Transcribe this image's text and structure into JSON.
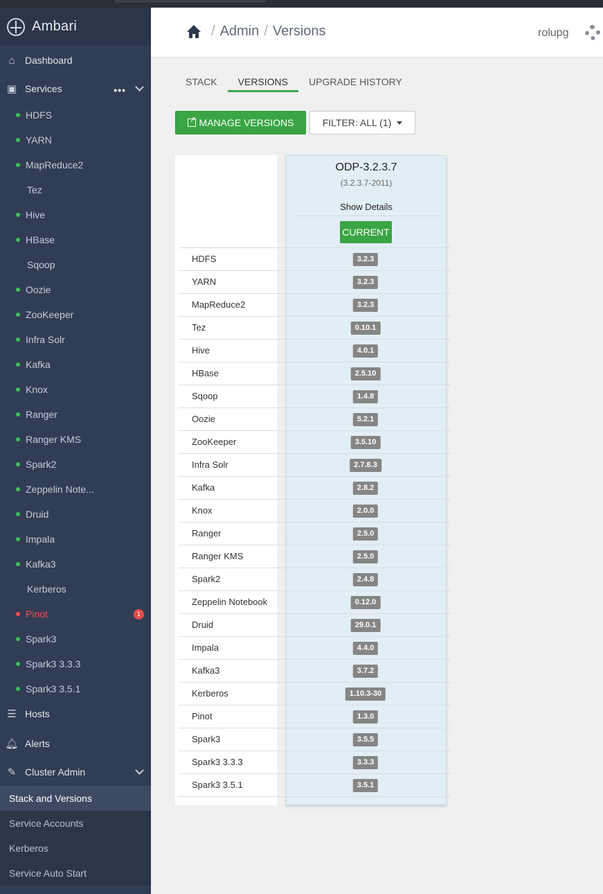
{
  "app": {
    "title": "Ambari"
  },
  "sidebar": {
    "dashboard": "Dashboard",
    "services": "Services",
    "services_more": "•••",
    "service_items": [
      {
        "label": "HDFS",
        "status": "green"
      },
      {
        "label": "YARN",
        "status": "green"
      },
      {
        "label": "MapReduce2",
        "status": "green"
      },
      {
        "label": "Tez",
        "status": "none"
      },
      {
        "label": "Hive",
        "status": "green"
      },
      {
        "label": "HBase",
        "status": "green"
      },
      {
        "label": "Sqoop",
        "status": "none"
      },
      {
        "label": "Oozie",
        "status": "green"
      },
      {
        "label": "ZooKeeper",
        "status": "green"
      },
      {
        "label": "Infra Solr",
        "status": "green"
      },
      {
        "label": "Kafka",
        "status": "green"
      },
      {
        "label": "Knox",
        "status": "green"
      },
      {
        "label": "Ranger",
        "status": "green"
      },
      {
        "label": "Ranger KMS",
        "status": "green"
      },
      {
        "label": "Spark2",
        "status": "green"
      },
      {
        "label": "Zeppelin Note...",
        "status": "green"
      },
      {
        "label": "Druid",
        "status": "green"
      },
      {
        "label": "Impala",
        "status": "green"
      },
      {
        "label": "Kafka3",
        "status": "green"
      },
      {
        "label": "Kerberos",
        "status": "none"
      },
      {
        "label": "Pinot",
        "status": "red",
        "alerts": "1"
      },
      {
        "label": "Spark3",
        "status": "green"
      },
      {
        "label": "Spark3 3.3.3",
        "status": "green"
      },
      {
        "label": "Spark3 3.5.1",
        "status": "green"
      }
    ],
    "hosts": "Hosts",
    "alerts": "Alerts",
    "cluster_admin": "Cluster Admin",
    "cluster_admin_items": [
      "Stack and Versions",
      "Service Accounts",
      "Kerberos",
      "Service Auto Start"
    ]
  },
  "header": {
    "crumb_admin": "Admin",
    "crumb_versions": "Versions",
    "separator": "/",
    "user": "rolupg"
  },
  "tabs": [
    "STACK",
    "VERSIONS",
    "UPGRADE HISTORY"
  ],
  "toolbar": {
    "manage_label": "MANAGE VERSIONS",
    "filter_label": "FILTER: ALL (1)"
  },
  "version": {
    "name": "ODP-3.2.3.7",
    "build": "(3.2.3.7-2011)",
    "show_details": "Show Details",
    "state": "CURRENT"
  },
  "components": [
    {
      "name": "HDFS",
      "version": "3.2.3"
    },
    {
      "name": "YARN",
      "version": "3.2.3"
    },
    {
      "name": "MapReduce2",
      "version": "3.2.3"
    },
    {
      "name": "Tez",
      "version": "0.10.1"
    },
    {
      "name": "Hive",
      "version": "4.0.1"
    },
    {
      "name": "HBase",
      "version": "2.5.10"
    },
    {
      "name": "Sqoop",
      "version": "1.4.8"
    },
    {
      "name": "Oozie",
      "version": "5.2.1"
    },
    {
      "name": "ZooKeeper",
      "version": "3.5.10"
    },
    {
      "name": "Infra Solr",
      "version": "2.7.8.3"
    },
    {
      "name": "Kafka",
      "version": "2.8.2"
    },
    {
      "name": "Knox",
      "version": "2.0.0"
    },
    {
      "name": "Ranger",
      "version": "2.5.0"
    },
    {
      "name": "Ranger KMS",
      "version": "2.5.0"
    },
    {
      "name": "Spark2",
      "version": "2.4.8"
    },
    {
      "name": "Zeppelin Notebook",
      "version": "0.12.0"
    },
    {
      "name": "Druid",
      "version": "29.0.1"
    },
    {
      "name": "Impala",
      "version": "4.4.0"
    },
    {
      "name": "Kafka3",
      "version": "3.7.2"
    },
    {
      "name": "Kerberos",
      "version": "1.10.3-30"
    },
    {
      "name": "Pinot",
      "version": "1.3.0"
    },
    {
      "name": "Spark3",
      "version": "3.5.5"
    },
    {
      "name": "Spark3 3.3.3",
      "version": "3.3.3"
    },
    {
      "name": "Spark3 3.5.1",
      "version": "3.5.1"
    }
  ],
  "colors": {
    "sidebar_bg": "#313d54",
    "accent_green": "#3aa545",
    "status_green": "#3fbf5c",
    "status_red": "#ef4f4f",
    "badge_gray": "#858585"
  }
}
